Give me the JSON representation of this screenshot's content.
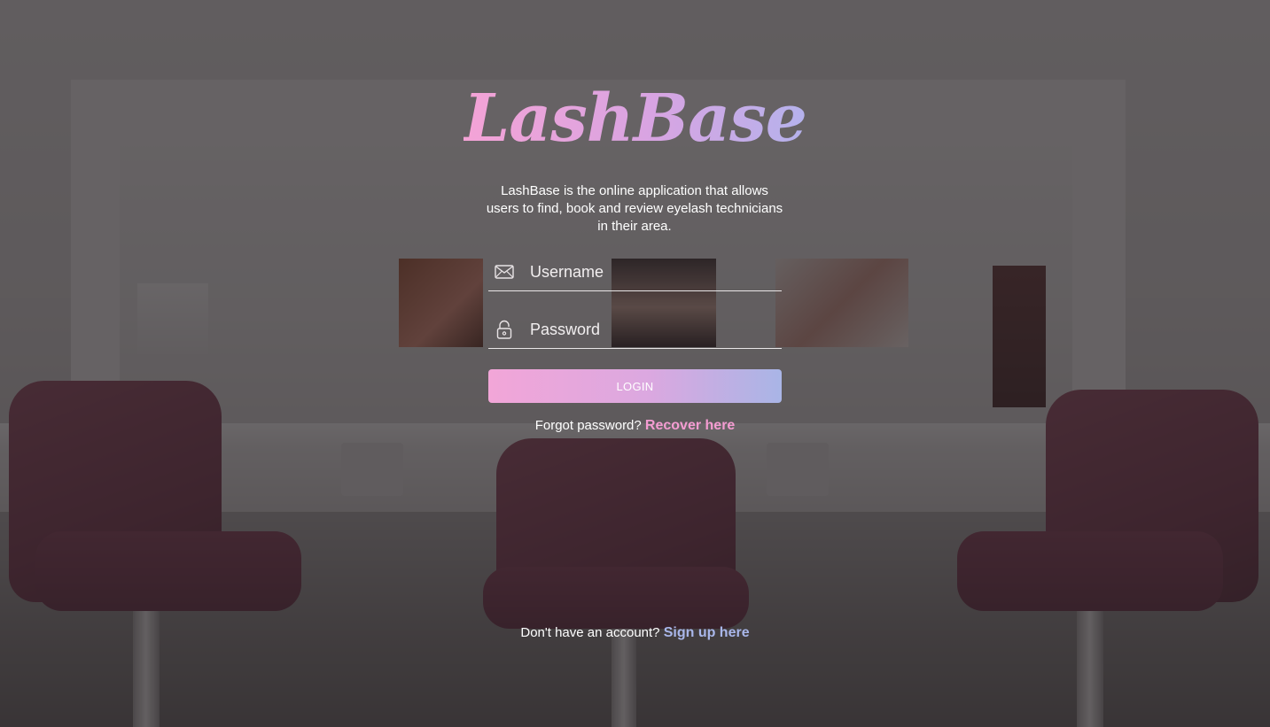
{
  "brand": {
    "name": "LashBase",
    "gradient_start": "#f4a3d6",
    "gradient_end": "#b5b2ec"
  },
  "tagline": "LashBase is the online application that allows users to find, book and review eyelash technicians in their area.",
  "form": {
    "username": {
      "placeholder": "Username",
      "value": "",
      "icon": "envelope-icon"
    },
    "password": {
      "placeholder": "Password",
      "value": "",
      "icon": "lock-icon"
    },
    "login_label": "LOGIN"
  },
  "recover": {
    "prompt": "Forgot password?",
    "link": "Recover here",
    "link_color": "#f49cd2"
  },
  "signup": {
    "prompt": "Don't have an account?",
    "link": "Sign up here",
    "link_color": "#a9b7ea"
  }
}
